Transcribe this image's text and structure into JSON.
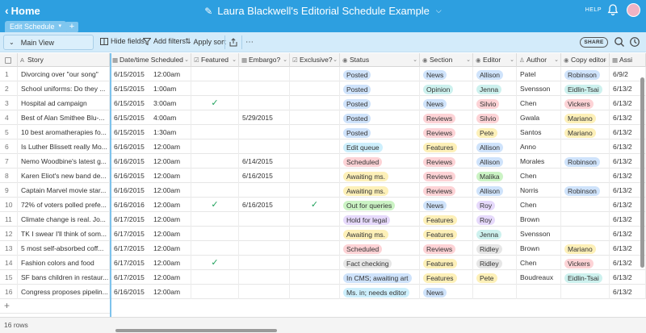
{
  "topbar": {
    "home_label": "Home",
    "title": "Laura Blackwell's Editorial Schedule Example",
    "help_label": "HELP"
  },
  "tabs": [
    {
      "label": "Edit Schedule"
    }
  ],
  "toolbar": {
    "view_label": "Main View",
    "hide_fields": "Hide fields",
    "add_filters": "Add filters",
    "apply_sort": "Apply sort",
    "share_label": "SHARE"
  },
  "columns": [
    {
      "label": "Story",
      "icon": "text-icon"
    },
    {
      "label": "Date/time Scheduled",
      "icon": "calendar-icon"
    },
    {
      "label": "Featured",
      "icon": "checkbox-icon"
    },
    {
      "label": "Embargo?",
      "icon": "calendar-icon"
    },
    {
      "label": "Exclusive?",
      "icon": "checkbox-icon"
    },
    {
      "label": "Status",
      "icon": "select-icon"
    },
    {
      "label": "Section",
      "icon": "select-icon"
    },
    {
      "label": "Editor",
      "icon": "select-icon"
    },
    {
      "label": "Author",
      "icon": "person-icon"
    },
    {
      "label": "Copy editor",
      "icon": "select-icon"
    },
    {
      "label": "Assi",
      "icon": "calendar-icon"
    }
  ],
  "colors": {
    "Posted": "#cfe3fb",
    "Edit queue": "#cdeffc",
    "Scheduled": "#fdd3d6",
    "Awaiting ms.": "#fdf0b8",
    "Out for queries": "#cbf3c4",
    "Hold for legal": "#e6d9fb",
    "Fact checking": "#e6e6e6",
    "In CMS; awaiting art": "#cfe3fb",
    "Ms. in; needs editor": "#cdeffc",
    "News": "#cfe3fb",
    "Opinion": "#cdf1ee",
    "Reviews": "#fdd3d6",
    "Features": "#fdf0b8",
    "Allison": "#cfe3fb",
    "Jenna": "#cdf1ee",
    "Silvio": "#fdd3d6",
    "Pete": "#fdf0b8",
    "Malika": "#cbf3c4",
    "Roy": "#e6d9fb",
    "Ridley": "#e6e6e6",
    "Robinson": "#cfe3fb",
    "Eidlin-Tsai": "#cdf1ee",
    "Vickers": "#fdd3d6",
    "Mariano": "#fdf0b8"
  },
  "rows": [
    {
      "n": "1",
      "story": "Divorcing over \"our song\"",
      "date": "6/15/2015",
      "time": "12:00am",
      "featured": false,
      "embargo": "",
      "exclusive": false,
      "status": "Posted",
      "section": "News",
      "editor": "Allison",
      "author": "Patel",
      "copy": "Robinson",
      "assign": "6/9/2"
    },
    {
      "n": "2",
      "story": "School uniforms: Do they ...",
      "date": "6/15/2015",
      "time": "1:00am",
      "featured": false,
      "embargo": "",
      "exclusive": false,
      "status": "Posted",
      "section": "Opinion",
      "editor": "Jenna",
      "author": "Svensson",
      "copy": "Eidlin-Tsai",
      "assign": "6/13/2"
    },
    {
      "n": "3",
      "story": "Hospital ad campaign",
      "date": "6/15/2015",
      "time": "3:00am",
      "featured": true,
      "embargo": "",
      "exclusive": false,
      "status": "Posted",
      "section": "News",
      "editor": "Silvio",
      "author": "Chen",
      "copy": "Vickers",
      "assign": "6/13/2"
    },
    {
      "n": "4",
      "story": "Best of Alan Smithee Blu-...",
      "date": "6/15/2015",
      "time": "4:00am",
      "featured": false,
      "embargo": "5/29/2015",
      "exclusive": false,
      "status": "Posted",
      "section": "Reviews",
      "editor": "Silvio",
      "author": "Gwala",
      "copy": "Mariano",
      "assign": "6/13/2"
    },
    {
      "n": "5",
      "story": "10 best aromatherapies fo...",
      "date": "6/15/2015",
      "time": "1:30am",
      "featured": false,
      "embargo": "",
      "exclusive": false,
      "status": "Posted",
      "section": "Reviews",
      "editor": "Pete",
      "author": "Santos",
      "copy": "Mariano",
      "assign": "6/13/2"
    },
    {
      "n": "6",
      "story": "Is Luther Blissett really Mo...",
      "date": "6/16/2015",
      "time": "12:00am",
      "featured": false,
      "embargo": "",
      "exclusive": false,
      "status": "Edit queue",
      "section": "Features",
      "editor": "Allison",
      "author": "Anno",
      "copy": "",
      "assign": "6/13/2"
    },
    {
      "n": "7",
      "story": "Nemo Woodbine's latest g...",
      "date": "6/16/2015",
      "time": "12:00am",
      "featured": false,
      "embargo": "6/14/2015",
      "exclusive": false,
      "status": "Scheduled",
      "section": "Reviews",
      "editor": "Allison",
      "author": "Morales",
      "copy": "Robinson",
      "assign": "6/13/2"
    },
    {
      "n": "8",
      "story": "Karen Eliot's new band de...",
      "date": "6/16/2015",
      "time": "12:00am",
      "featured": false,
      "embargo": "6/16/2015",
      "exclusive": false,
      "status": "Awaiting ms.",
      "section": "Reviews",
      "editor": "Malika",
      "author": "Chen",
      "copy": "",
      "assign": "6/13/2"
    },
    {
      "n": "9",
      "story": "Captain Marvel movie star...",
      "date": "6/16/2015",
      "time": "12:00am",
      "featured": false,
      "embargo": "",
      "exclusive": false,
      "status": "Awaiting ms.",
      "section": "Reviews",
      "editor": "Allison",
      "author": "Norris",
      "copy": "Robinson",
      "assign": "6/13/2"
    },
    {
      "n": "10",
      "story": "72% of voters polled prefe...",
      "date": "6/16/2016",
      "time": "12:00am",
      "featured": true,
      "embargo": "6/16/2015",
      "exclusive": true,
      "status": "Out for queries",
      "section": "News",
      "editor": "Roy",
      "author": "Chen",
      "copy": "",
      "assign": "6/13/2"
    },
    {
      "n": "11",
      "story": "Climate change is real. Jo...",
      "date": "6/17/2015",
      "time": "12:00am",
      "featured": false,
      "embargo": "",
      "exclusive": false,
      "status": "Hold for legal",
      "section": "Features",
      "editor": "Roy",
      "author": "Brown",
      "copy": "",
      "assign": "6/13/2"
    },
    {
      "n": "12",
      "story": "TK I swear I'll think of som...",
      "date": "6/17/2015",
      "time": "12:00am",
      "featured": false,
      "embargo": "",
      "exclusive": false,
      "status": "Awaiting ms.",
      "section": "Features",
      "editor": "Jenna",
      "author": "Svensson",
      "copy": "",
      "assign": "6/13/2"
    },
    {
      "n": "13",
      "story": "5 most self-absorbed coff...",
      "date": "6/17/2015",
      "time": "12:00am",
      "featured": false,
      "embargo": "",
      "exclusive": false,
      "status": "Scheduled",
      "section": "Reviews",
      "editor": "Ridley",
      "author": "Brown",
      "copy": "Mariano",
      "assign": "6/13/2"
    },
    {
      "n": "14",
      "story": "Fashion colors and food",
      "date": "6/17/2015",
      "time": "12:00am",
      "featured": true,
      "embargo": "",
      "exclusive": false,
      "status": "Fact checking",
      "section": "Features",
      "editor": "Ridley",
      "author": "Chen",
      "copy": "Vickers",
      "assign": "6/13/2"
    },
    {
      "n": "15",
      "story": "SF bans children in restaur...",
      "date": "6/17/2015",
      "time": "12:00am",
      "featured": false,
      "embargo": "",
      "exclusive": false,
      "status": "In CMS; awaiting art",
      "section": "Features",
      "editor": "Pete",
      "author": "Boudreaux",
      "copy": "Eidlin-Tsai",
      "assign": "6/13/2"
    },
    {
      "n": "16",
      "story": "Congress proposes pipelin...",
      "date": "6/16/2015",
      "time": "12:00am",
      "featured": false,
      "embargo": "",
      "exclusive": false,
      "status": "Ms. in; needs editor",
      "section": "News",
      "editor": "",
      "author": "",
      "copy": "",
      "assign": "6/13/2"
    }
  ],
  "footer": {
    "row_count": "16 rows"
  }
}
